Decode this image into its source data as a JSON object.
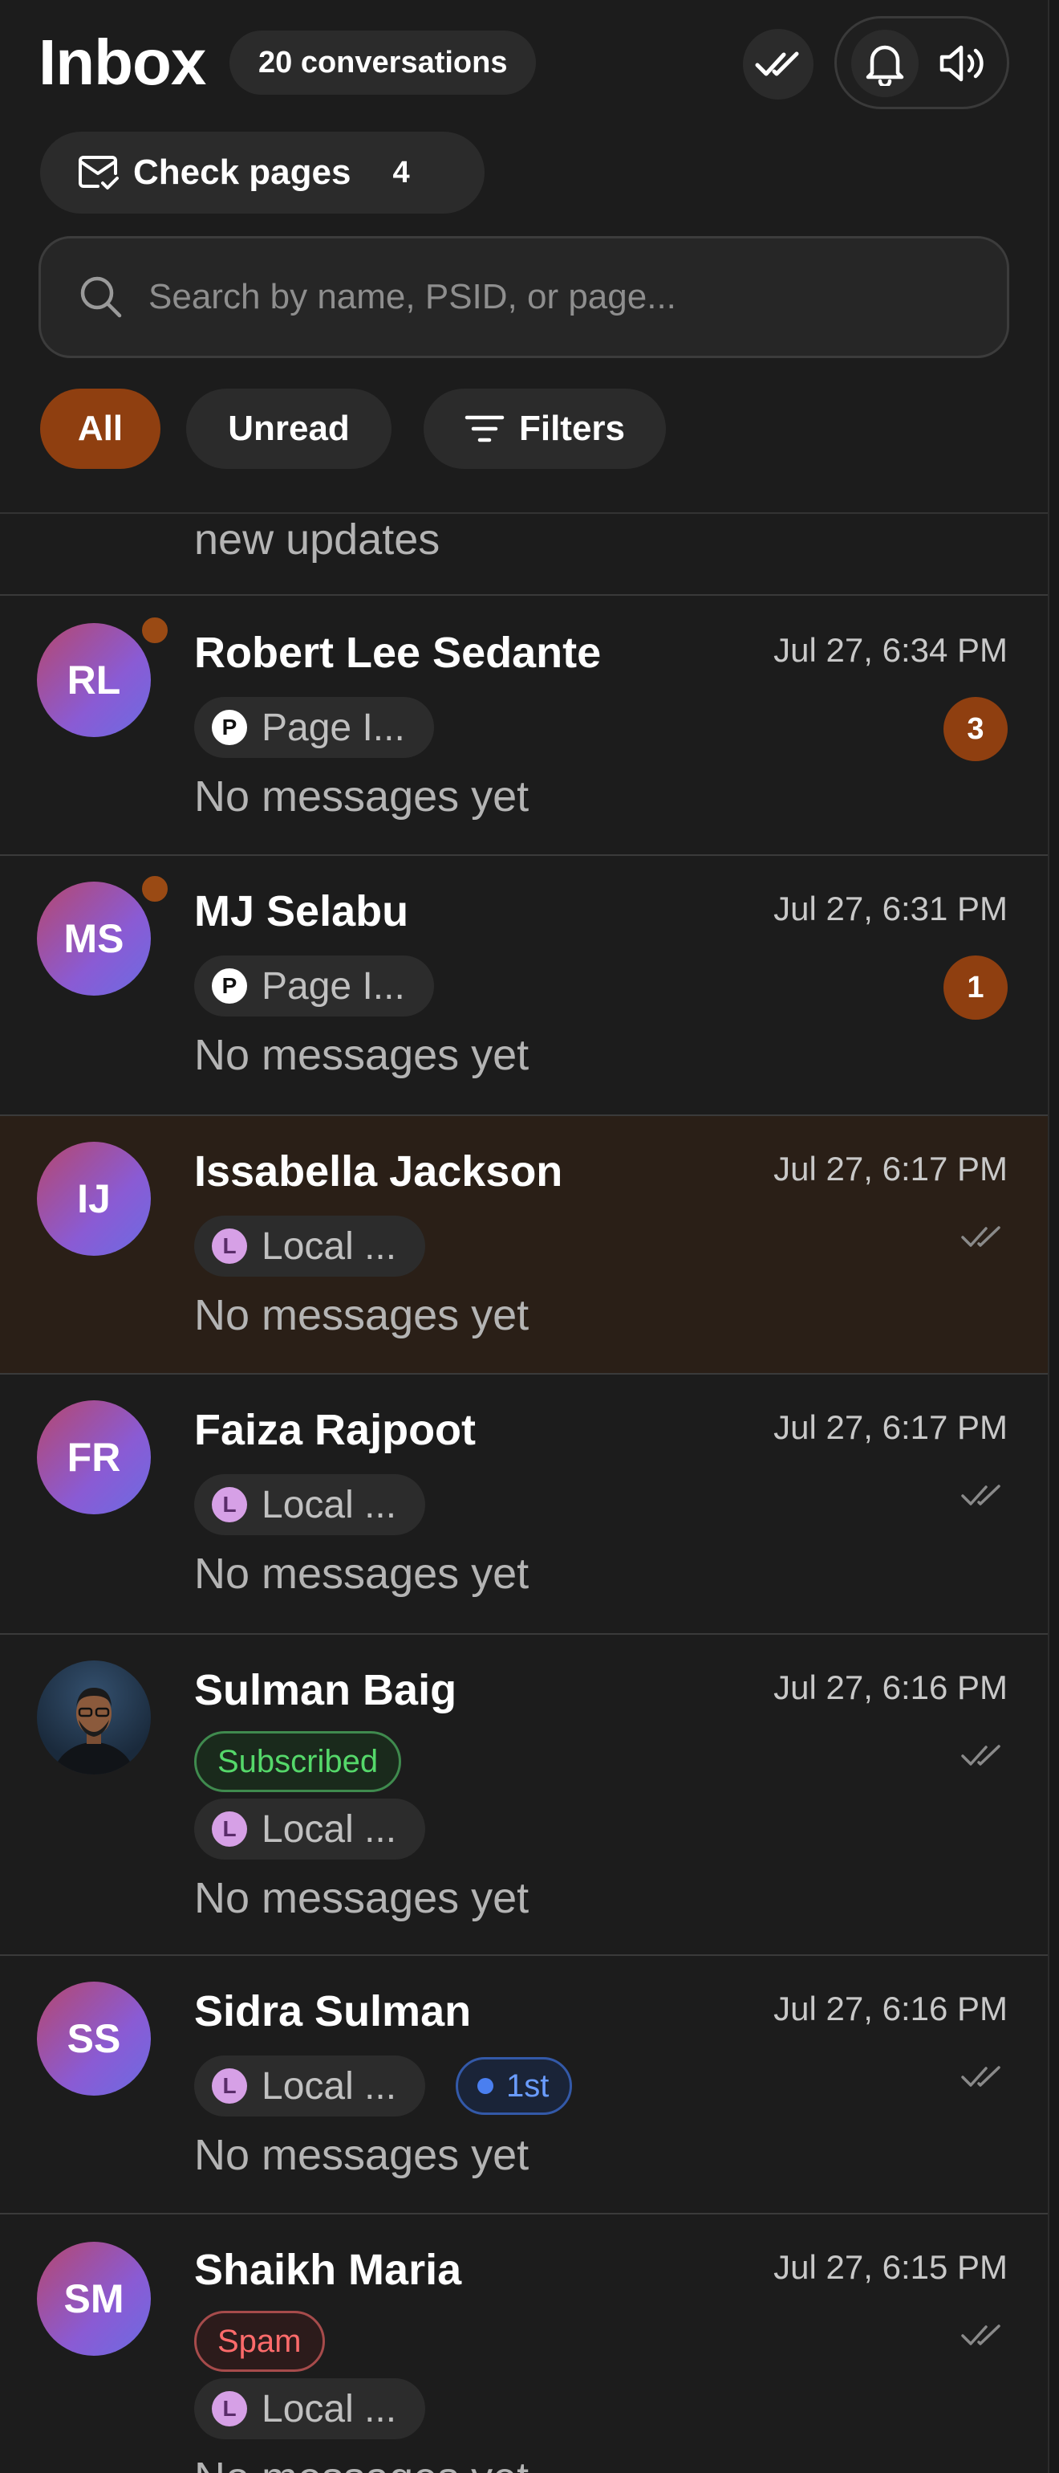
{
  "header": {
    "title": "Inbox",
    "conversation_count": "20 conversations",
    "check_pages_label": "Check pages",
    "check_pages_count": "4"
  },
  "search": {
    "placeholder": "Search by name, PSID, or page..."
  },
  "filters": {
    "all": "All",
    "unread": "Unread",
    "filters": "Filters",
    "active": "All"
  },
  "partial_row": {
    "preview": "new updates"
  },
  "conversations": [
    {
      "initials": "RL",
      "name": "Robert Lee Sedante",
      "time": "Jul 27, 6:34 PM",
      "page": "Page I...",
      "page_icon": "P",
      "preview": "No messages yet",
      "unread": "3",
      "online": true
    },
    {
      "initials": "MS",
      "name": "MJ Selabu",
      "time": "Jul 27, 6:31 PM",
      "page": "Page I...",
      "page_icon": "P",
      "preview": "No messages yet",
      "unread": "1",
      "online": true
    },
    {
      "initials": "IJ",
      "name": "Issabella Jackson",
      "time": "Jul 27, 6:17 PM",
      "page": "Local ...",
      "page_icon": "L",
      "preview": "No messages yet",
      "selected": true,
      "read_icon": "double-check-icon"
    },
    {
      "initials": "FR",
      "name": "Faiza Rajpoot",
      "time": "Jul 27, 6:17 PM",
      "page": "Local ...",
      "page_icon": "L",
      "preview": "No messages yet",
      "read_icon": "double-check-icon"
    },
    {
      "initials": "",
      "name": "Sulman Baig",
      "time": "Jul 27, 6:16 PM",
      "status": "Subscribed",
      "page": "Local ...",
      "page_icon": "L",
      "preview": "No messages yet",
      "read_icon": "double-check-icon"
    },
    {
      "initials": "SS",
      "name": "Sidra Sulman",
      "time": "Jul 27, 6:16 PM",
      "page": "Local ...",
      "page_icon": "L",
      "tag": "1st",
      "preview": "No messages yet",
      "read_icon": "double-check-icon"
    },
    {
      "initials": "SM",
      "name": "Shaikh Maria",
      "time": "Jul 27, 6:15 PM",
      "status": "Spam",
      "page": "Local ...",
      "page_icon": "L",
      "preview": "No messages yet",
      "read_icon": "double-check-icon"
    }
  ],
  "colors": {
    "accent": "#8f3f10",
    "background": "#1c1c1c",
    "selected_row": "#2a1f17",
    "subscribed": "#55d86a",
    "spam": "#ff6b6b",
    "first_tag": "#6a9cff"
  }
}
